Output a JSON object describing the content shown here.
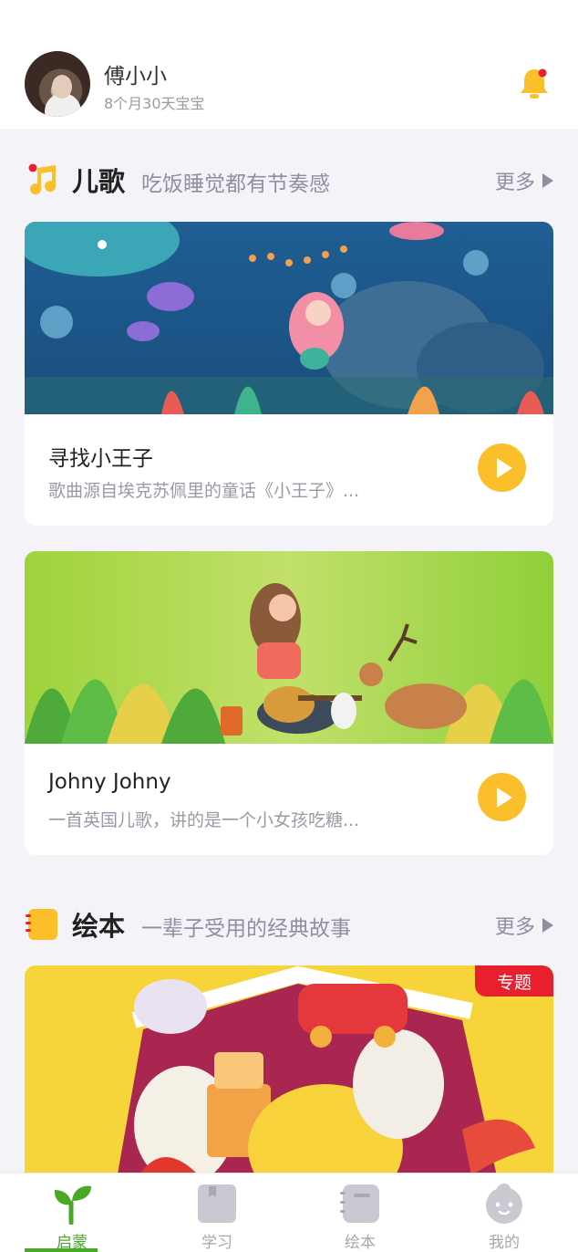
{
  "user": {
    "name": "傅小小",
    "age": "8个月30天宝宝"
  },
  "header": {
    "bell_icon": "bell-icon",
    "has_notification": true
  },
  "songs_section": {
    "icon": "music-note-icon",
    "title": "儿歌",
    "subtitle": "吃饭睡觉都有节奏感",
    "more_label": "更多"
  },
  "songs": [
    {
      "title": "寻找小王子",
      "description": "歌曲源自埃克苏佩里的童话《小王子》..."
    },
    {
      "title": "Johny Johny",
      "description": "一首英国儿歌，讲的是一个小女孩吃糖..."
    }
  ],
  "books_section": {
    "icon": "book-icon",
    "title": "绘本",
    "subtitle": "一辈子受用的经典故事",
    "more_label": "更多"
  },
  "book_banner": {
    "tag": "专题"
  },
  "tabs": [
    {
      "label": "启蒙",
      "icon": "sprout-icon",
      "active": true
    },
    {
      "label": "学习",
      "icon": "bookmark-book-icon",
      "active": false
    },
    {
      "label": "绘本",
      "icon": "notebook-icon",
      "active": false
    },
    {
      "label": "我的",
      "icon": "baby-face-icon",
      "active": false
    }
  ],
  "colors": {
    "accent_yellow": "#fbbf2c",
    "active_green": "#4aa827",
    "tag_red": "#e8202e",
    "notification_red": "#e8202e"
  }
}
